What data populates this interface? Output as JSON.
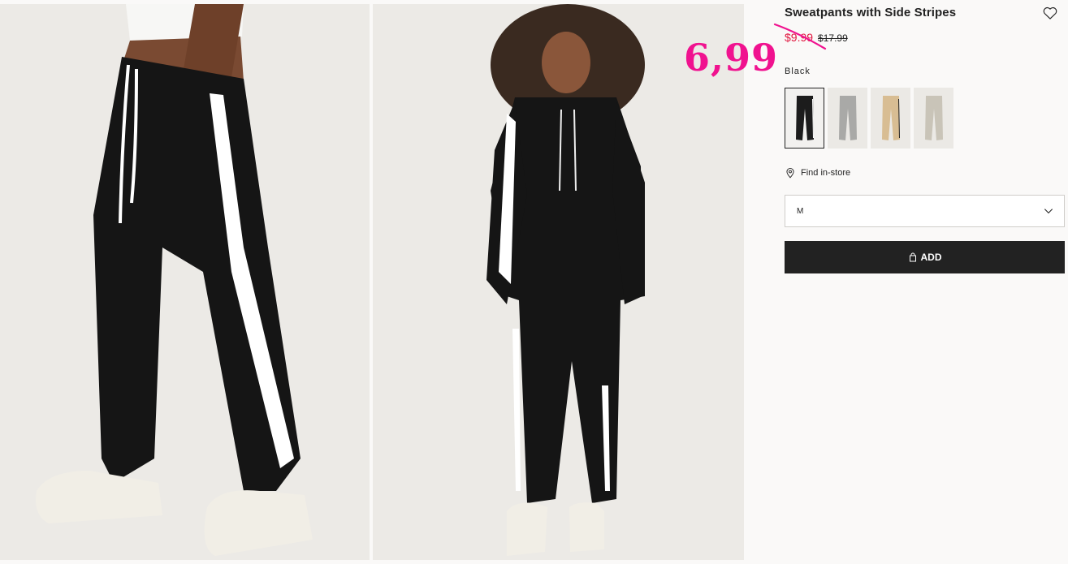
{
  "product": {
    "title": "Sweatpants with Side Stripes",
    "sale_price": "$9.99",
    "original_price": "$17.99",
    "annotated_price": "6,99",
    "color_label": "Black",
    "swatches": [
      {
        "name": "Black",
        "color": "#1c1c1c"
      },
      {
        "name": "Grey",
        "color": "#a9a9a7"
      },
      {
        "name": "Beige",
        "color": "#d8bd93"
      },
      {
        "name": "Light beige",
        "color": "#c9c4b8"
      }
    ],
    "find_in_store": "Find in-store",
    "selected_size": "M",
    "add_label": "ADD"
  },
  "icons": {
    "favorite": "heart-icon",
    "location": "map-pin-icon",
    "dropdown": "chevron-down-icon",
    "bag": "shopping-bag-icon"
  },
  "colors": {
    "sale": "#e0173f",
    "annotation": "#f0128f",
    "button": "#222222"
  }
}
